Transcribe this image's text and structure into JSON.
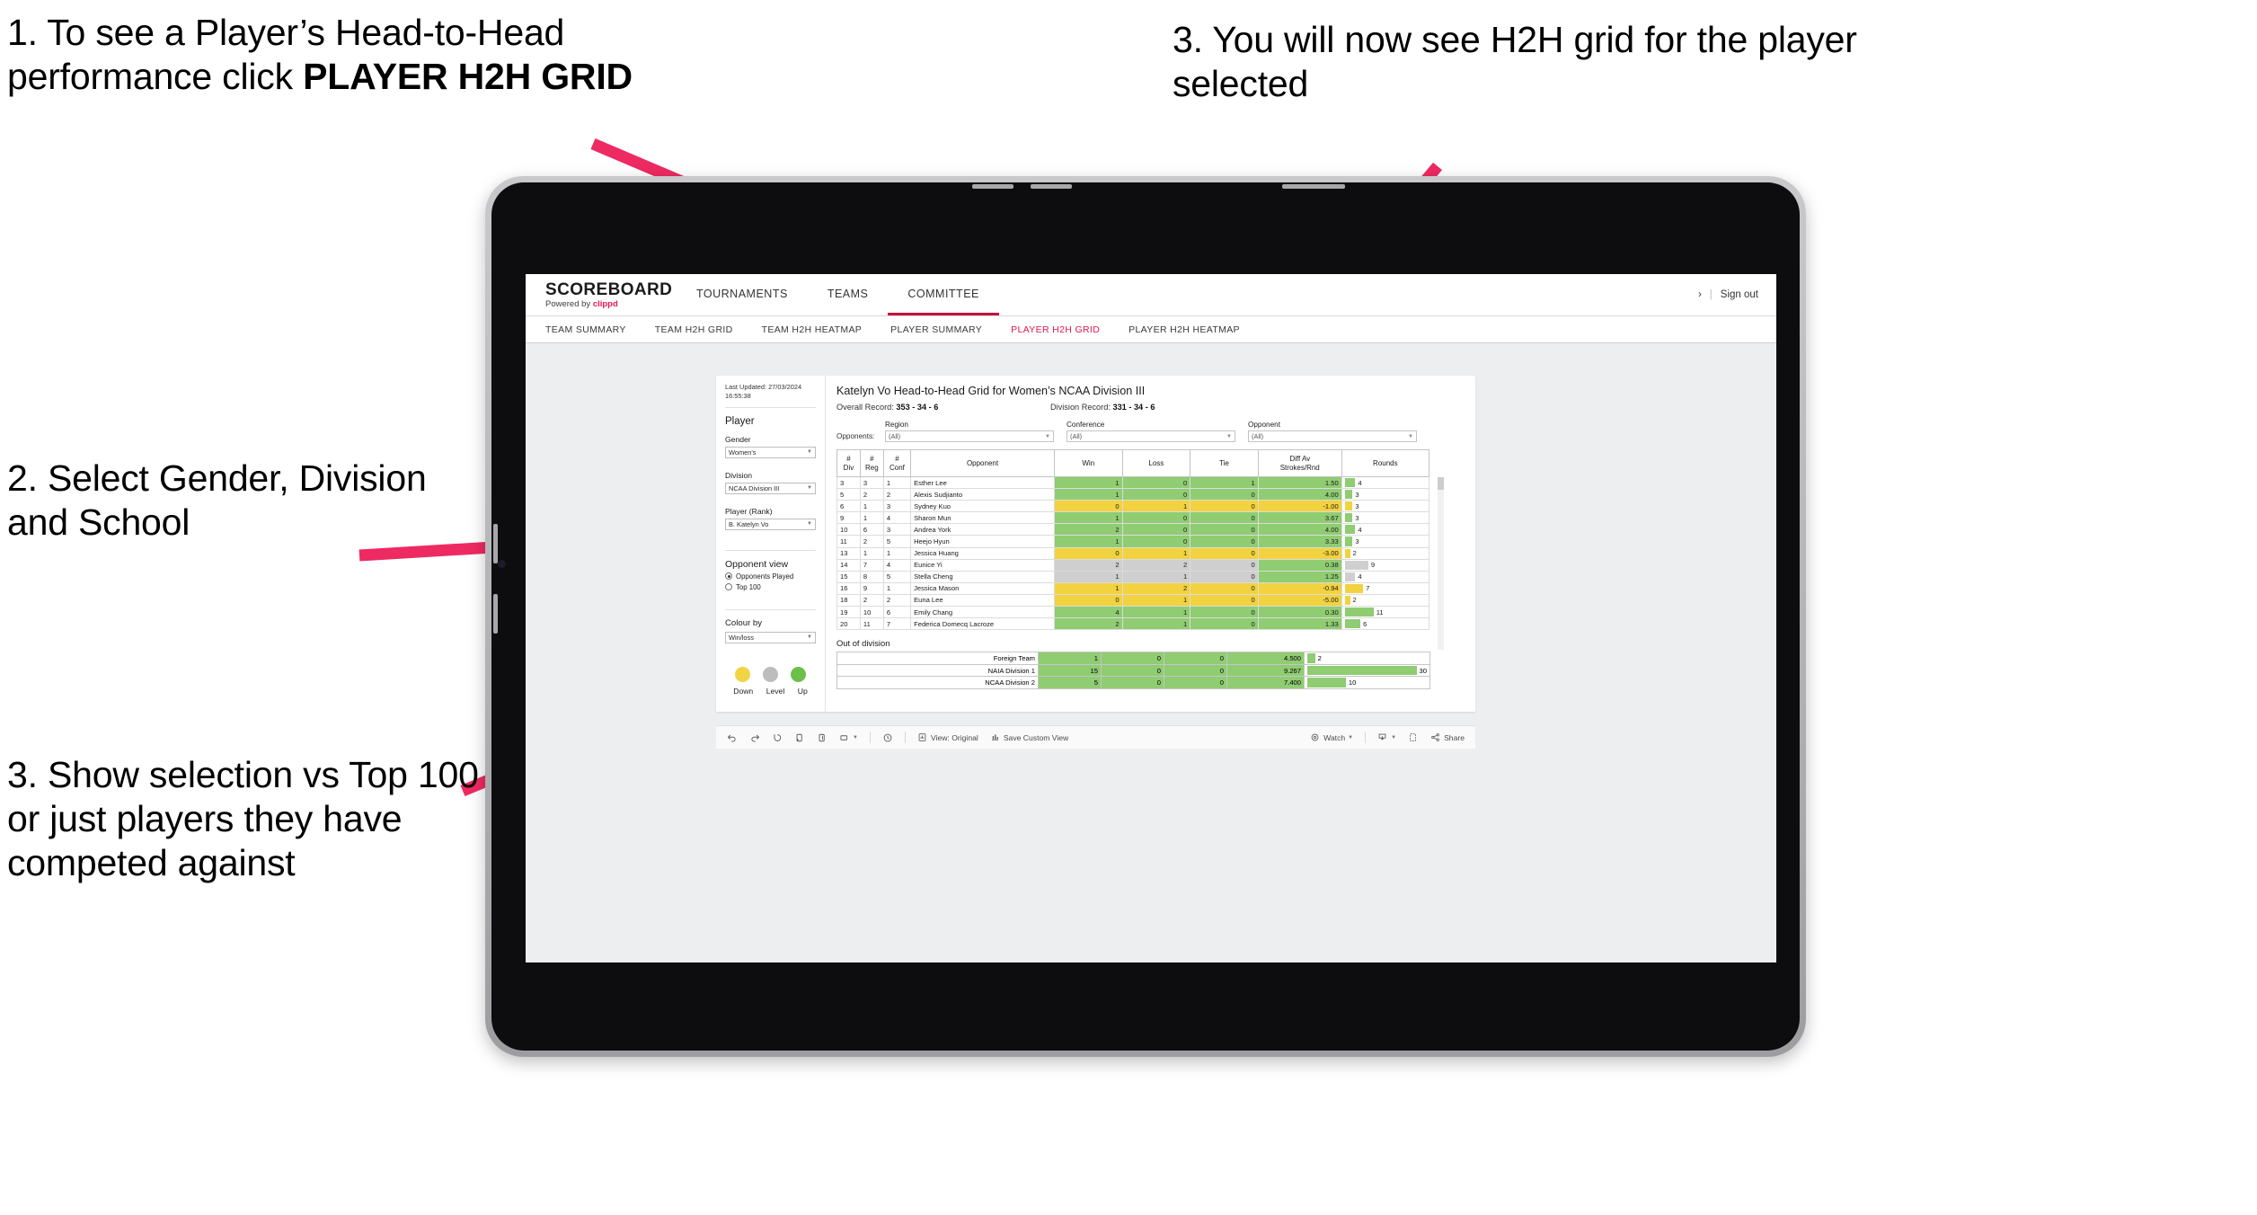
{
  "annotations": {
    "step1_prefix": "1. To see a Player’s Head-to-Head performance click ",
    "step1_bold": "PLAYER H2H GRID",
    "step2": "2. Select Gender, Division and School",
    "step3_left": "3. Show selection vs Top 100 or just players they have competed against",
    "step3_right": "3. You will now see H2H grid for the player selected",
    "arrow_color": "#ee2a62"
  },
  "app": {
    "logo": {
      "main": "SCOREBOARD",
      "powered_prefix": "Powered by ",
      "brand": "clippd"
    },
    "top_nav": [
      {
        "label": "TOURNAMENTS",
        "active": false
      },
      {
        "label": "TEAMS",
        "active": false
      },
      {
        "label": "COMMITTEE",
        "active": true
      }
    ],
    "top_right": {
      "chevron": "›",
      "divider": "|",
      "sign_out": "Sign out"
    },
    "sub_nav": [
      {
        "label": "TEAM SUMMARY",
        "active": false
      },
      {
        "label": "TEAM H2H GRID",
        "active": false
      },
      {
        "label": "TEAM H2H HEATMAP",
        "active": false
      },
      {
        "label": "PLAYER SUMMARY",
        "active": false
      },
      {
        "label": "PLAYER H2H GRID",
        "active": true
      },
      {
        "label": "PLAYER H2H HEATMAP",
        "active": false
      }
    ],
    "accent_color": "#e8174c"
  },
  "sidebar": {
    "last_updated_line1": "Last Updated: 27/03/2024",
    "last_updated_line2": "16:55:38",
    "player_heading": "Player",
    "filters": [
      {
        "label": "Gender",
        "value": "Women's"
      },
      {
        "label": "Division",
        "value": "NCAA Division III"
      },
      {
        "label": "Player (Rank)",
        "value": "B. Katelyn Vo"
      }
    ],
    "opponent_view": {
      "heading": "Opponent view",
      "options": [
        {
          "label": "Opponents Played",
          "selected": true
        },
        {
          "label": "Top 100",
          "selected": false
        }
      ]
    },
    "colour_by": {
      "label": "Colour by",
      "value": "Win/loss"
    },
    "legend": [
      {
        "label": "Down",
        "color": "#f0d444"
      },
      {
        "label": "Level",
        "color": "#bdbdbd"
      },
      {
        "label": "Up",
        "color": "#6cbf4b"
      }
    ]
  },
  "main": {
    "title": "Katelyn Vo Head-to-Head Grid for Women’s NCAA Division III",
    "overall_record_label": "Overall Record: ",
    "overall_record_value": "353 - 34 - 6",
    "division_record_label": "Division Record: ",
    "division_record_value": "331 - 34 - 6",
    "opponents_label": "Opponents:",
    "opponent_filters": [
      {
        "label": "Region",
        "value": "(All)"
      },
      {
        "label": "Conference",
        "value": "(All)"
      },
      {
        "label": "Opponent",
        "value": "(All)"
      }
    ],
    "table_headers": [
      "#\nDiv",
      "#\nReg",
      "#\nConf",
      "Opponent",
      "Win",
      "Loss",
      "Tie",
      "Diff Av\nStrokes/Rnd",
      "Rounds"
    ],
    "out_of_division_title": "Out of division"
  },
  "chart_data": {
    "type": "table",
    "title": "Katelyn Vo Head-to-Head Grid for Women’s NCAA Division III",
    "columns": [
      "#Div",
      "#Reg",
      "#Conf",
      "Opponent",
      "Win",
      "Loss",
      "Tie",
      "Diff Av Strokes/Rnd",
      "Rounds"
    ],
    "rows": [
      {
        "div": "3",
        "reg": "3",
        "conf": "1",
        "opponent": "Esther Lee",
        "win": "1",
        "loss": "0",
        "tie": "1",
        "diff": "1.50",
        "rounds": "4",
        "color": "green"
      },
      {
        "div": "5",
        "reg": "2",
        "conf": "2",
        "opponent": "Alexis Sudjianto",
        "win": "1",
        "loss": "0",
        "tie": "0",
        "diff": "4.00",
        "rounds": "3",
        "color": "green"
      },
      {
        "div": "6",
        "reg": "1",
        "conf": "3",
        "opponent": "Sydney Kuo",
        "win": "0",
        "loss": "1",
        "tie": "0",
        "diff": "-1.00",
        "rounds": "3",
        "color": "yellow"
      },
      {
        "div": "9",
        "reg": "1",
        "conf": "4",
        "opponent": "Sharon Mun",
        "win": "1",
        "loss": "0",
        "tie": "0",
        "diff": "3.67",
        "rounds": "3",
        "color": "green"
      },
      {
        "div": "10",
        "reg": "6",
        "conf": "3",
        "opponent": "Andrea York",
        "win": "2",
        "loss": "0",
        "tie": "0",
        "diff": "4.00",
        "rounds": "4",
        "color": "green"
      },
      {
        "div": "11",
        "reg": "2",
        "conf": "5",
        "opponent": "Heejo Hyun",
        "win": "1",
        "loss": "0",
        "tie": "0",
        "diff": "3.33",
        "rounds": "3",
        "color": "green"
      },
      {
        "div": "13",
        "reg": "1",
        "conf": "1",
        "opponent": "Jessica Huang",
        "win": "0",
        "loss": "1",
        "tie": "0",
        "diff": "-3.00",
        "rounds": "2",
        "color": "yellow"
      },
      {
        "div": "14",
        "reg": "7",
        "conf": "4",
        "opponent": "Eunice Yi",
        "win": "2",
        "loss": "2",
        "tie": "0",
        "diff": "0.38",
        "rounds": "9",
        "color": "grey",
        "diff_color": "green"
      },
      {
        "div": "15",
        "reg": "8",
        "conf": "5",
        "opponent": "Stella Cheng",
        "win": "1",
        "loss": "1",
        "tie": "0",
        "diff": "1.25",
        "rounds": "4",
        "color": "grey",
        "diff_color": "green"
      },
      {
        "div": "16",
        "reg": "9",
        "conf": "1",
        "opponent": "Jessica Mason",
        "win": "1",
        "loss": "2",
        "tie": "0",
        "diff": "-0.94",
        "rounds": "7",
        "color": "yellow"
      },
      {
        "div": "18",
        "reg": "2",
        "conf": "2",
        "opponent": "Euna Lee",
        "win": "0",
        "loss": "1",
        "tie": "0",
        "diff": "-5.00",
        "rounds": "2",
        "color": "yellow"
      },
      {
        "div": "19",
        "reg": "10",
        "conf": "6",
        "opponent": "Emily Chang",
        "win": "4",
        "loss": "1",
        "tie": "0",
        "diff": "0.30",
        "rounds": "11",
        "color": "green"
      },
      {
        "div": "20",
        "reg": "11",
        "conf": "7",
        "opponent": "Federica Domecq Lacroze",
        "win": "2",
        "loss": "1",
        "tie": "0",
        "diff": "1.33",
        "rounds": "6",
        "color": "green"
      }
    ],
    "out_of_division": [
      {
        "name": "Foreign Team",
        "win": "1",
        "loss": "0",
        "tie": "0",
        "diff": "4.500",
        "rounds": "2",
        "color": "green"
      },
      {
        "name": "NAIA Division 1",
        "win": "15",
        "loss": "0",
        "tie": "0",
        "diff": "9.267",
        "rounds": "30",
        "color": "green"
      },
      {
        "name": "NCAA Division 2",
        "win": "5",
        "loss": "0",
        "tie": "0",
        "diff": "7.400",
        "rounds": "10",
        "color": "green"
      }
    ],
    "rounds_max": 31
  },
  "toolbar": {
    "items": [
      {
        "name": "undo-icon",
        "label": ""
      },
      {
        "name": "redo-icon",
        "label": ""
      },
      {
        "name": "revert-icon",
        "label": ""
      },
      {
        "name": "refresh-icon",
        "label": ""
      },
      {
        "name": "pause-icon",
        "label": ""
      },
      {
        "name": "device-layout-icon",
        "label": ""
      }
    ],
    "view_original": "View: Original",
    "save_custom_view": "Save Custom View",
    "watch": "Watch",
    "share": "Share"
  }
}
